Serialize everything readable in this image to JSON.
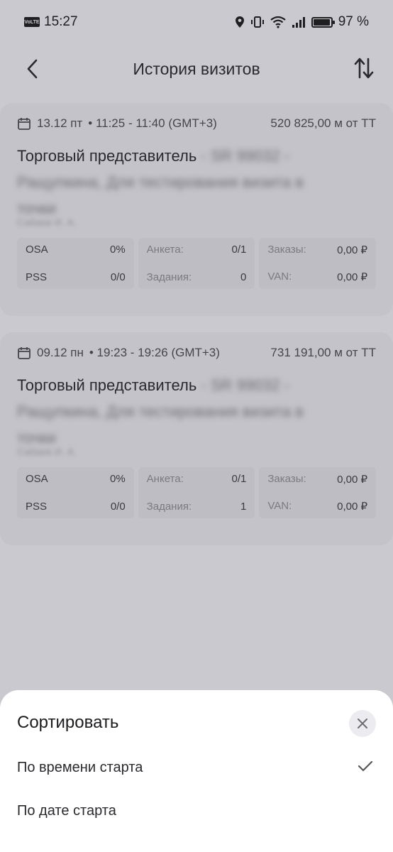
{
  "status_bar": {
    "volte": "VoLTE",
    "time": "15:27",
    "battery_text": "97 %",
    "battery_level": 0.97
  },
  "header": {
    "title": "История визитов"
  },
  "visits": [
    {
      "date": "13.12 пт",
      "time_range": "• 11:25 - 11:40 (GMT+3)",
      "distance": "520 825,00 м от ТТ",
      "title_main": "Торговый представитель",
      "title_blurred_1": " - SR 99032 -",
      "title_blurred_2": "Ращупкина, Для тестирования визита в",
      "title_blurred_3": "точки",
      "author": "Сабаев И. А.",
      "metrics": {
        "osa_label": "OSA",
        "osa_value": "0%",
        "pss_label": "PSS",
        "pss_value": "0/0",
        "anketa_label": "Анкета:",
        "anketa_value": "0/1",
        "zadaniya_label": "Задания:",
        "zadaniya_value": "0",
        "zakazy_label": "Заказы:",
        "zakazy_value": "0,00 ₽",
        "van_label": "VAN:",
        "van_value": "0,00 ₽"
      }
    },
    {
      "date": "09.12 пн",
      "time_range": "• 19:23 - 19:26 (GMT+3)",
      "distance": "731 191,00 м от ТТ",
      "title_main": "Торговый представитель",
      "title_blurred_1": " - SR 99032 -",
      "title_blurred_2": "Ращупкина, Для тестирования визита в",
      "title_blurred_3": "точки",
      "author": "Сабаев И. А.",
      "metrics": {
        "osa_label": "OSA",
        "osa_value": "0%",
        "pss_label": "PSS",
        "pss_value": "0/0",
        "anketa_label": "Анкета:",
        "anketa_value": "0/1",
        "zadaniya_label": "Задания:",
        "zadaniya_value": "1",
        "zakazy_label": "Заказы:",
        "zakazy_value": "0,00 ₽",
        "van_label": "VAN:",
        "van_value": "0,00 ₽"
      }
    }
  ],
  "sort_sheet": {
    "title": "Сортировать",
    "options": [
      {
        "label": "По времени старта",
        "selected": true
      },
      {
        "label": "По дате старта",
        "selected": false
      }
    ]
  },
  "colors": {
    "overlay_background": "#c9c9cf",
    "sheet_background": "#ffffff",
    "text_primary": "#2a2a2e"
  },
  "icons": [
    "back-arrow-icon",
    "sort-icon",
    "calendar-icon",
    "close-icon",
    "check-icon",
    "location-icon",
    "vibrate-icon",
    "wifi-icon",
    "signal-icon",
    "battery-icon"
  ]
}
